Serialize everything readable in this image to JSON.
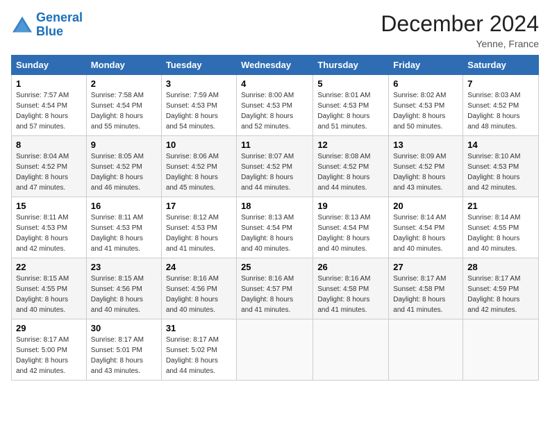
{
  "header": {
    "logo_line1": "General",
    "logo_line2": "Blue",
    "title": "December 2024",
    "subtitle": "Yenne, France"
  },
  "days_of_week": [
    "Sunday",
    "Monday",
    "Tuesday",
    "Wednesday",
    "Thursday",
    "Friday",
    "Saturday"
  ],
  "weeks": [
    [
      {
        "day": "1",
        "info": "Sunrise: 7:57 AM\nSunset: 4:54 PM\nDaylight: 8 hours\nand 57 minutes."
      },
      {
        "day": "2",
        "info": "Sunrise: 7:58 AM\nSunset: 4:54 PM\nDaylight: 8 hours\nand 55 minutes."
      },
      {
        "day": "3",
        "info": "Sunrise: 7:59 AM\nSunset: 4:53 PM\nDaylight: 8 hours\nand 54 minutes."
      },
      {
        "day": "4",
        "info": "Sunrise: 8:00 AM\nSunset: 4:53 PM\nDaylight: 8 hours\nand 52 minutes."
      },
      {
        "day": "5",
        "info": "Sunrise: 8:01 AM\nSunset: 4:53 PM\nDaylight: 8 hours\nand 51 minutes."
      },
      {
        "day": "6",
        "info": "Sunrise: 8:02 AM\nSunset: 4:53 PM\nDaylight: 8 hours\nand 50 minutes."
      },
      {
        "day": "7",
        "info": "Sunrise: 8:03 AM\nSunset: 4:52 PM\nDaylight: 8 hours\nand 48 minutes."
      }
    ],
    [
      {
        "day": "8",
        "info": "Sunrise: 8:04 AM\nSunset: 4:52 PM\nDaylight: 8 hours\nand 47 minutes."
      },
      {
        "day": "9",
        "info": "Sunrise: 8:05 AM\nSunset: 4:52 PM\nDaylight: 8 hours\nand 46 minutes."
      },
      {
        "day": "10",
        "info": "Sunrise: 8:06 AM\nSunset: 4:52 PM\nDaylight: 8 hours\nand 45 minutes."
      },
      {
        "day": "11",
        "info": "Sunrise: 8:07 AM\nSunset: 4:52 PM\nDaylight: 8 hours\nand 44 minutes."
      },
      {
        "day": "12",
        "info": "Sunrise: 8:08 AM\nSunset: 4:52 PM\nDaylight: 8 hours\nand 44 minutes."
      },
      {
        "day": "13",
        "info": "Sunrise: 8:09 AM\nSunset: 4:52 PM\nDaylight: 8 hours\nand 43 minutes."
      },
      {
        "day": "14",
        "info": "Sunrise: 8:10 AM\nSunset: 4:53 PM\nDaylight: 8 hours\nand 42 minutes."
      }
    ],
    [
      {
        "day": "15",
        "info": "Sunrise: 8:11 AM\nSunset: 4:53 PM\nDaylight: 8 hours\nand 42 minutes."
      },
      {
        "day": "16",
        "info": "Sunrise: 8:11 AM\nSunset: 4:53 PM\nDaylight: 8 hours\nand 41 minutes."
      },
      {
        "day": "17",
        "info": "Sunrise: 8:12 AM\nSunset: 4:53 PM\nDaylight: 8 hours\nand 41 minutes."
      },
      {
        "day": "18",
        "info": "Sunrise: 8:13 AM\nSunset: 4:54 PM\nDaylight: 8 hours\nand 40 minutes."
      },
      {
        "day": "19",
        "info": "Sunrise: 8:13 AM\nSunset: 4:54 PM\nDaylight: 8 hours\nand 40 minutes."
      },
      {
        "day": "20",
        "info": "Sunrise: 8:14 AM\nSunset: 4:54 PM\nDaylight: 8 hours\nand 40 minutes."
      },
      {
        "day": "21",
        "info": "Sunrise: 8:14 AM\nSunset: 4:55 PM\nDaylight: 8 hours\nand 40 minutes."
      }
    ],
    [
      {
        "day": "22",
        "info": "Sunrise: 8:15 AM\nSunset: 4:55 PM\nDaylight: 8 hours\nand 40 minutes."
      },
      {
        "day": "23",
        "info": "Sunrise: 8:15 AM\nSunset: 4:56 PM\nDaylight: 8 hours\nand 40 minutes."
      },
      {
        "day": "24",
        "info": "Sunrise: 8:16 AM\nSunset: 4:56 PM\nDaylight: 8 hours\nand 40 minutes."
      },
      {
        "day": "25",
        "info": "Sunrise: 8:16 AM\nSunset: 4:57 PM\nDaylight: 8 hours\nand 41 minutes."
      },
      {
        "day": "26",
        "info": "Sunrise: 8:16 AM\nSunset: 4:58 PM\nDaylight: 8 hours\nand 41 minutes."
      },
      {
        "day": "27",
        "info": "Sunrise: 8:17 AM\nSunset: 4:58 PM\nDaylight: 8 hours\nand 41 minutes."
      },
      {
        "day": "28",
        "info": "Sunrise: 8:17 AM\nSunset: 4:59 PM\nDaylight: 8 hours\nand 42 minutes."
      }
    ],
    [
      {
        "day": "29",
        "info": "Sunrise: 8:17 AM\nSunset: 5:00 PM\nDaylight: 8 hours\nand 42 minutes."
      },
      {
        "day": "30",
        "info": "Sunrise: 8:17 AM\nSunset: 5:01 PM\nDaylight: 8 hours\nand 43 minutes."
      },
      {
        "day": "31",
        "info": "Sunrise: 8:17 AM\nSunset: 5:02 PM\nDaylight: 8 hours\nand 44 minutes."
      },
      {
        "day": "",
        "info": ""
      },
      {
        "day": "",
        "info": ""
      },
      {
        "day": "",
        "info": ""
      },
      {
        "day": "",
        "info": ""
      }
    ]
  ]
}
